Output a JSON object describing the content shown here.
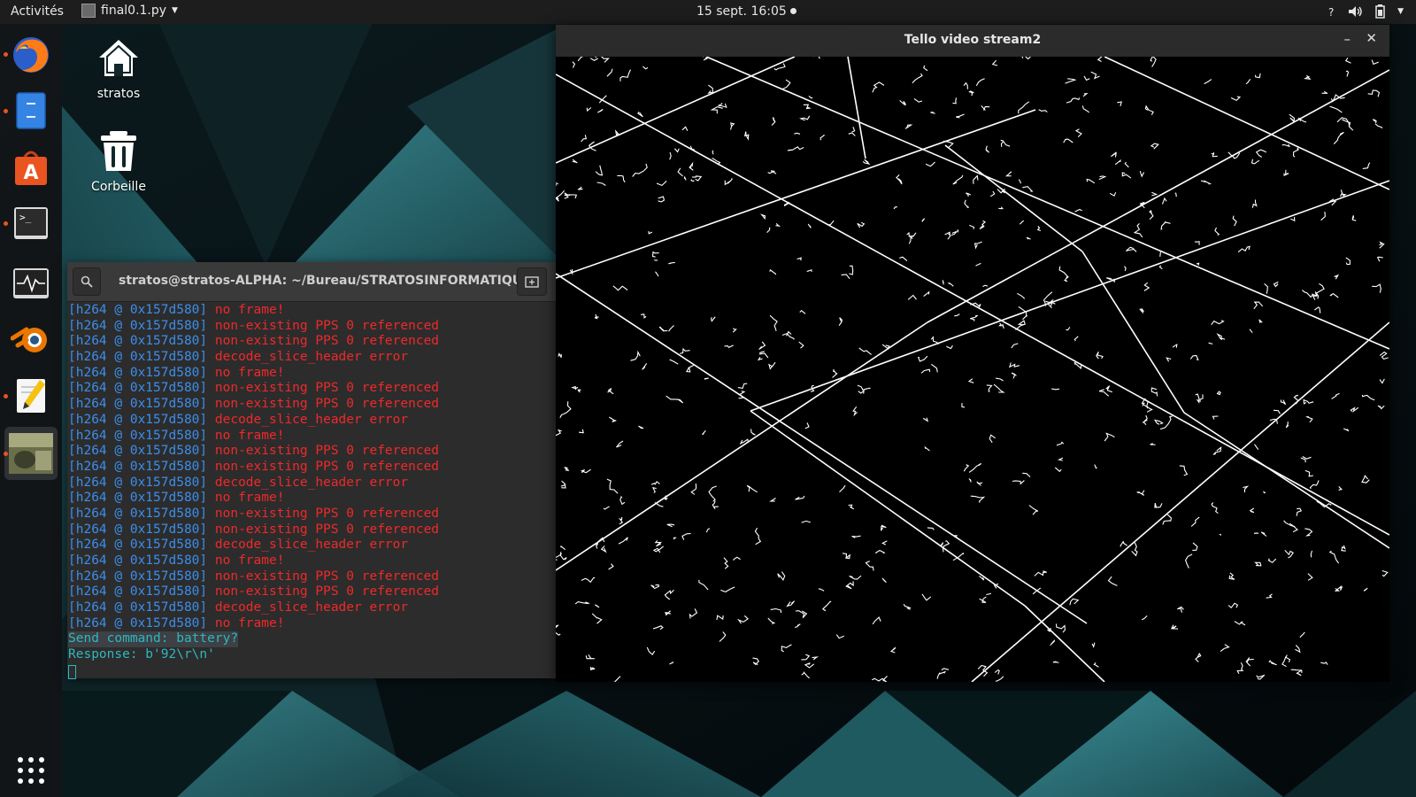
{
  "topbar": {
    "activities": "Activités",
    "app_name": "final0.1.py",
    "clock": "15 sept.  16:05",
    "icons": [
      "question-icon",
      "volume-icon",
      "battery-icon",
      "system-menu-caret"
    ]
  },
  "dock": {
    "items": [
      {
        "name": "firefox",
        "running": true
      },
      {
        "name": "files",
        "running": true
      },
      {
        "name": "software-center",
        "running": false
      },
      {
        "name": "terminal",
        "running": true
      },
      {
        "name": "system-monitor",
        "running": false
      },
      {
        "name": "blender",
        "running": false
      },
      {
        "name": "text-editor",
        "running": true
      },
      {
        "name": "video-window-thumbnail",
        "running": true
      }
    ],
    "show_apps_icon": "grid-icon"
  },
  "desktop": {
    "icons": [
      {
        "label": "stratos",
        "icon": "home-icon"
      },
      {
        "label": "Corbeille",
        "icon": "trash-icon"
      }
    ]
  },
  "terminal": {
    "title": "stratos@stratos-ALPHA: ~/Bureau/STRATOSINFORMATIQU...",
    "prefix": "[h264 @ 0x157d580]",
    "log": [
      "no frame!",
      "non-existing PPS 0 referenced",
      "non-existing PPS 0 referenced",
      "decode_slice_header error",
      "no frame!",
      "non-existing PPS 0 referenced",
      "non-existing PPS 0 referenced",
      "decode_slice_header error",
      "no frame!",
      "non-existing PPS 0 referenced",
      "non-existing PPS 0 referenced",
      "decode_slice_header error",
      "no frame!",
      "non-existing PPS 0 referenced",
      "non-existing PPS 0 referenced",
      "decode_slice_header error",
      "no frame!",
      "non-existing PPS 0 referenced",
      "non-existing PPS 0 referenced",
      "decode_slice_header error",
      "no frame!"
    ],
    "command_line": "Send command: battery?",
    "response_line": "Response: b'92\\r\\n'"
  },
  "video_window": {
    "title": "Tello video stream2",
    "minimize": "–",
    "close": "✕"
  },
  "colors": {
    "log_prefix": "#3b8eea",
    "log_error": "#ef2929",
    "prompt_text": "#2fb7c0",
    "accent": "#e95420"
  }
}
